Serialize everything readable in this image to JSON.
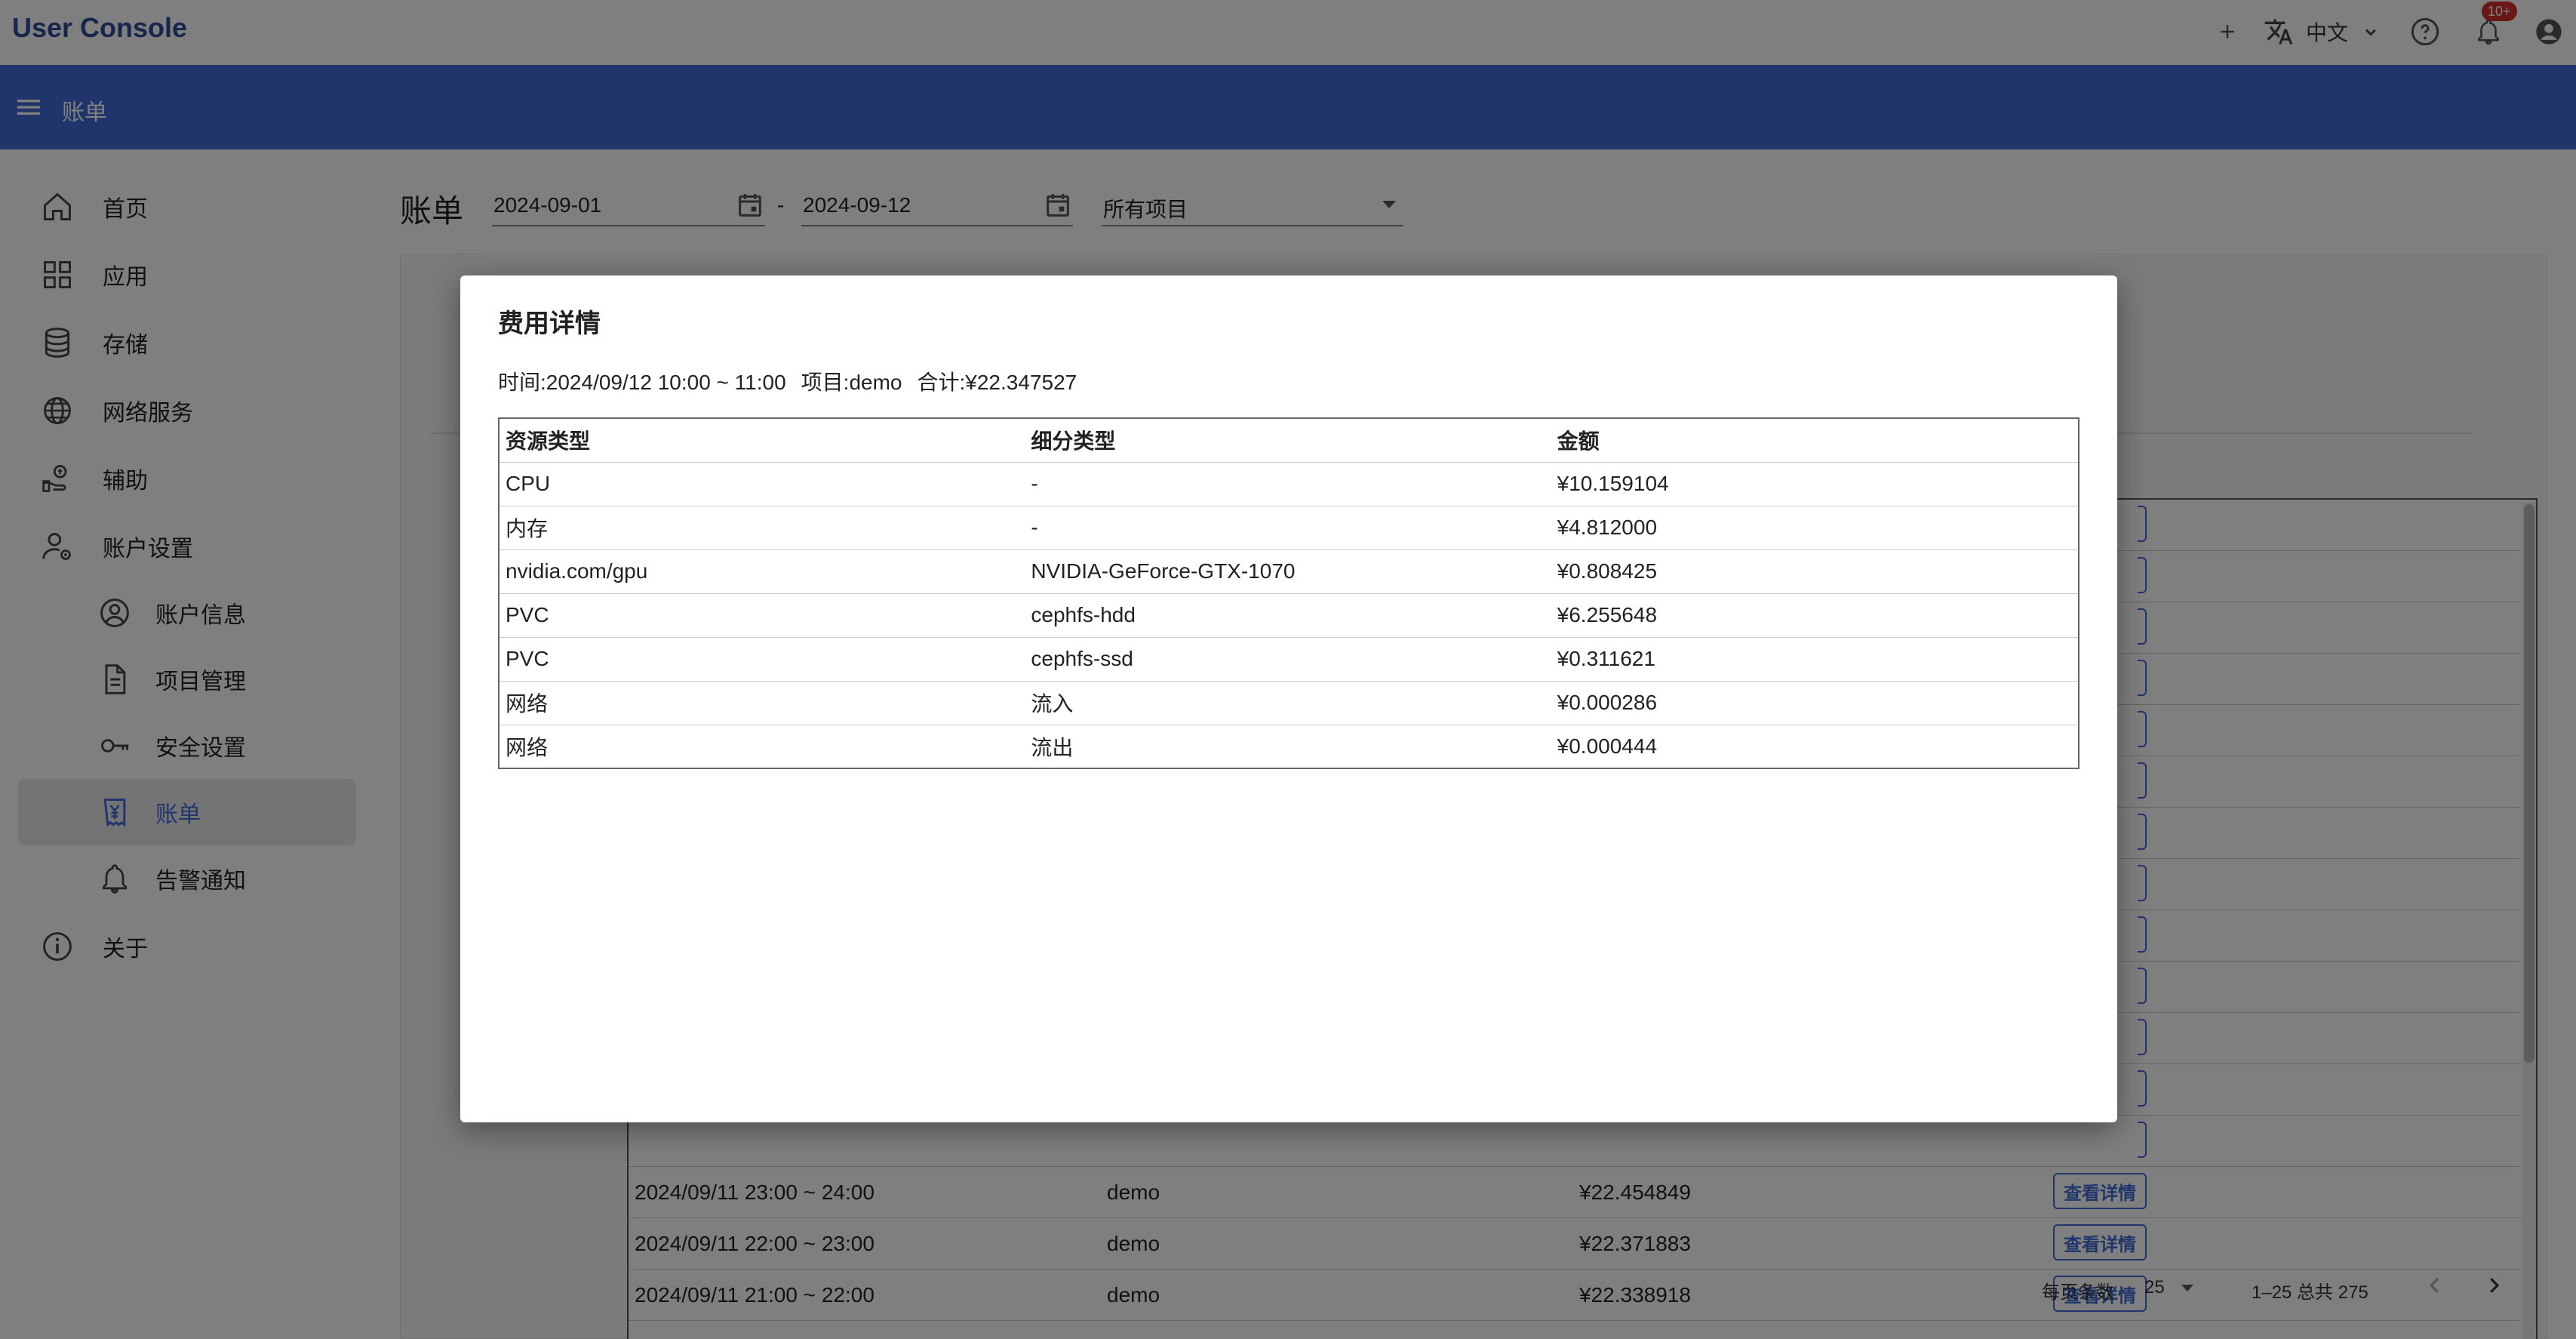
{
  "header": {
    "app_title": "User Console",
    "language": "中文",
    "notification_badge": "10+"
  },
  "appbar": {
    "breadcrumb": "账单"
  },
  "sidebar": {
    "items": [
      {
        "label": "首页",
        "icon": "home-icon"
      },
      {
        "label": "应用",
        "icon": "apps-icon"
      },
      {
        "label": "存储",
        "icon": "database-icon"
      },
      {
        "label": "网络服务",
        "icon": "globe-icon"
      },
      {
        "label": "辅助",
        "icon": "support-icon"
      },
      {
        "label": "账户设置",
        "icon": "user-settings-icon"
      },
      {
        "label": "账户信息",
        "icon": "account-circle-icon"
      },
      {
        "label": "项目管理",
        "icon": "document-icon"
      },
      {
        "label": "安全设置",
        "icon": "key-icon"
      },
      {
        "label": "账单",
        "icon": "bill-icon",
        "active": true
      },
      {
        "label": "告警通知",
        "icon": "bell-icon"
      },
      {
        "label": "关于",
        "icon": "info-icon"
      }
    ]
  },
  "main": {
    "title": "账单",
    "start_date": "2024-09-01",
    "date_separator": "-",
    "end_date": "2024-09-12",
    "project_filter": "所有项目"
  },
  "bills": {
    "detail_button_label": "查看详情",
    "visible_rows": [
      {
        "time": "2024/09/11 23:00 ~ 24:00",
        "project": "demo",
        "amount": "¥22.454849"
      },
      {
        "time": "2024/09/11 22:00 ~ 23:00",
        "project": "demo",
        "amount": "¥22.371883"
      },
      {
        "time": "2024/09/11 21:00 ~ 22:00",
        "project": "demo",
        "amount": "¥22.338918"
      }
    ],
    "pagination": {
      "rows_per_page_label": "每页条数",
      "rows_per_page": "25",
      "range": "1–25 总共 275"
    }
  },
  "modal": {
    "title": "费用详情",
    "time_label": "时间:2024/09/12 10:00 ~ 11:00",
    "project_label": "项目:demo",
    "total_label": "合计:¥22.347527",
    "columns": [
      "资源类型",
      "细分类型",
      "金额"
    ],
    "rows": [
      [
        "CPU",
        "-",
        "¥10.159104"
      ],
      [
        "内存",
        "-",
        "¥4.812000"
      ],
      [
        "nvidia.com/gpu",
        "NVIDIA-GeForce-GTX-1070",
        "¥0.808425"
      ],
      [
        "PVC",
        "cephfs-hdd",
        "¥6.255648"
      ],
      [
        "PVC",
        "cephfs-ssd",
        "¥0.311621"
      ],
      [
        "网络",
        "流入",
        "¥0.000286"
      ],
      [
        "网络",
        "流出",
        "¥0.000444"
      ]
    ]
  },
  "colors": {
    "brand": "#2c4e96",
    "appbar": "#3f6bd8",
    "badge": "#d32f2f"
  }
}
